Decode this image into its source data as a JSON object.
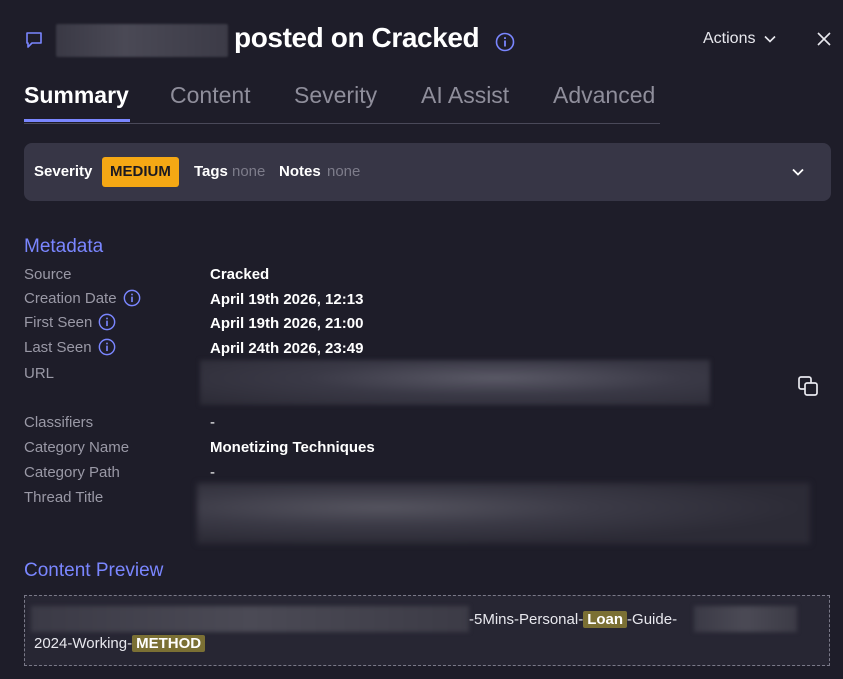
{
  "header": {
    "title": "posted on Cracked",
    "actions_label": "Actions"
  },
  "tabs": [
    {
      "label": "Summary",
      "active": true
    },
    {
      "label": "Content",
      "active": false
    },
    {
      "label": "Severity",
      "active": false
    },
    {
      "label": "AI Assist",
      "active": false
    },
    {
      "label": "Advanced",
      "active": false
    }
  ],
  "severity_bar": {
    "severity_label": "Severity",
    "severity_value": "MEDIUM",
    "severity_color": "#f5a814",
    "tags_label": "Tags",
    "tags_value": "none",
    "notes_label": "Notes",
    "notes_value": "none"
  },
  "metadata": {
    "title": "Metadata",
    "rows": [
      {
        "label": "Source",
        "value": "Cracked",
        "info": false
      },
      {
        "label": "Creation Date",
        "value": "April 19th 2026, 12:13",
        "info": true
      },
      {
        "label": "First Seen",
        "value": "April 19th 2026, 21:00",
        "info": true
      },
      {
        "label": "Last Seen",
        "value": "April 24th 2026, 23:49",
        "info": true
      },
      {
        "label": "URL",
        "value": "",
        "info": false
      },
      {
        "label": "Classifiers",
        "value": "-",
        "info": false
      },
      {
        "label": "Category Name",
        "value": "Monetizing Techniques",
        "info": false
      },
      {
        "label": "Category Path",
        "value": "-",
        "info": false
      },
      {
        "label": "Thread Title",
        "value": "",
        "info": false
      }
    ]
  },
  "content_preview": {
    "title": "Content Preview",
    "line1_a": "-5Mins-Personal-",
    "line1_hl": "Loan",
    "line1_b": "-Guide-",
    "line2_a": "2024-Working-",
    "line2_hl": "METHOD"
  },
  "colors": {
    "accent": "#7a86ff",
    "background": "#1e1d29",
    "highlight": "#7b7034"
  },
  "icons": [
    "chat-bubble-icon",
    "info-icon",
    "chevron-down-icon",
    "close-icon",
    "copy-icon"
  ]
}
